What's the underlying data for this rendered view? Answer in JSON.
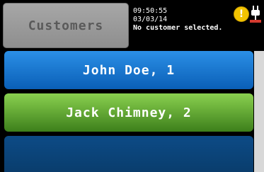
{
  "header": {
    "title": "Customers",
    "time": "09:50:55",
    "date": "03/03/14",
    "message": "No customer selected."
  },
  "status_icons": [
    {
      "name": "warning-icon",
      "glyph": "!"
    },
    {
      "name": "power-plug-icon"
    }
  ],
  "customers": [
    {
      "label": "John Doe, 1",
      "color": "#1f7fd7"
    },
    {
      "label": "Jack Chimney, 2",
      "color": "#67b436"
    }
  ]
}
